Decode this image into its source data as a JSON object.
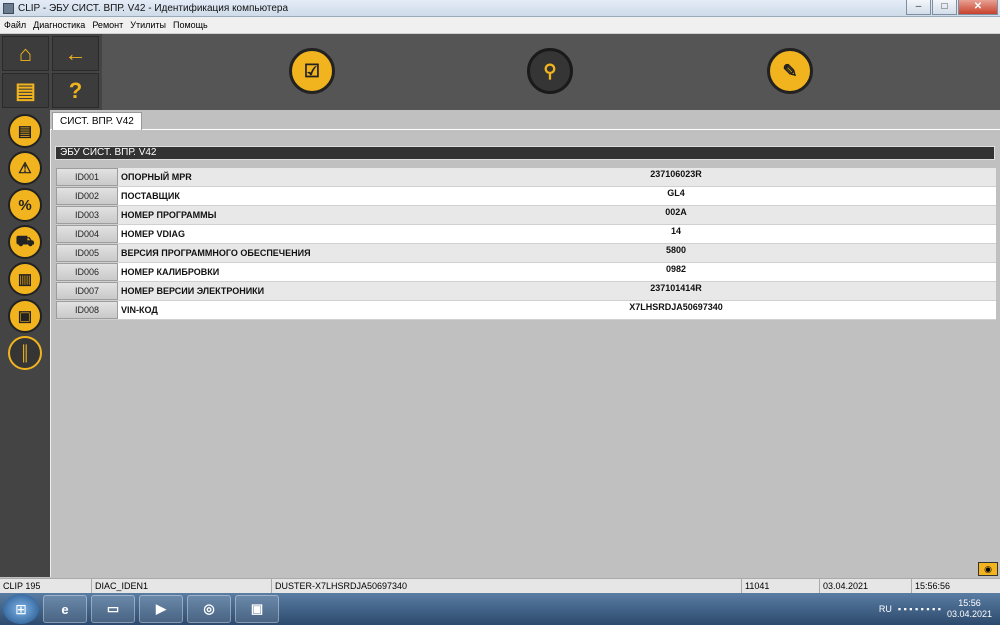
{
  "window": {
    "title": "CLIP - ЭБУ СИСТ. ВПР. V42 - Идентификация компьютера",
    "ctrl_min": "–",
    "ctrl_max": "□",
    "ctrl_close": "✕"
  },
  "menu": [
    "Файл",
    "Диагностика",
    "Ремонт",
    "Утилиты",
    "Помощь"
  ],
  "tab": {
    "label": "СИСТ. ВПР. V42"
  },
  "section": {
    "title": "ЭБУ СИСТ. ВПР. V42"
  },
  "rows": [
    {
      "id": "ID001",
      "label": "ОПОРНЫЙ MPR",
      "value": "237106023R"
    },
    {
      "id": "ID002",
      "label": "ПОСТАВЩИК",
      "value": "GL4"
    },
    {
      "id": "ID003",
      "label": "НОМЕР ПРОГРАММЫ",
      "value": "002A"
    },
    {
      "id": "ID004",
      "label": "НОМЕР VDIAG",
      "value": "14"
    },
    {
      "id": "ID005",
      "label": "ВЕРСИЯ ПРОГРАММНОГО ОБЕСПЕЧЕНИЯ",
      "value": "5800"
    },
    {
      "id": "ID006",
      "label": "НОМЕР КАЛИБРОВКИ",
      "value": "0982"
    },
    {
      "id": "ID007",
      "label": "НОМЕР ВЕРСИИ ЭЛЕКТРОНИКИ",
      "value": "237101414R"
    },
    {
      "id": "ID008",
      "label": "VIN-КОД",
      "value": "X7LHSRDJA50697340"
    }
  ],
  "status": {
    "clip": "CLIP 195",
    "diag": "DIAC_IDEN1",
    "vehicle": "DUSTER-X7LHSRDJA50697340",
    "code": "11041",
    "date": "03.04.2021",
    "time": "15:56:56"
  },
  "taskbar": {
    "lang": "RU",
    "clock_time": "15:56",
    "clock_date": "03.04.2021"
  },
  "icons": {
    "home": "home-icon",
    "back": "arrow-left-icon",
    "print": "printer-icon",
    "help": "question-icon"
  },
  "colors": {
    "accent": "#f2b41e",
    "toolbar": "#555555",
    "sidebar": "#444444"
  }
}
